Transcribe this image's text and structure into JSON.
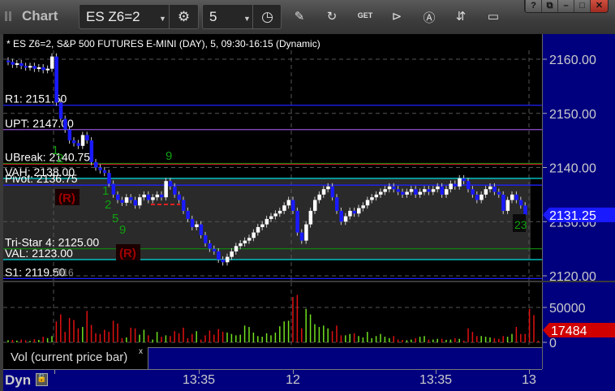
{
  "window": {
    "title": "Chart",
    "buttons": [
      "?",
      "restore",
      "minimize",
      "maximize",
      "close"
    ]
  },
  "toolbar": {
    "symbol": "ES Z6=2",
    "interval": "5",
    "tools": [
      "settings-icon",
      "clock-icon",
      "pencil-icon",
      "refresh-chart-icon",
      "get-icon",
      "play-icon",
      "analysis-a-icon",
      "link-icon",
      "comment-icon"
    ]
  },
  "header": {
    "description": "* ES Z6=2, S&P 500 FUTURES E-MINI (DAY), 5, 09:30-16:15 (Dynamic)"
  },
  "price_axis": {
    "ticks": [
      "2160.00",
      "2150.00",
      "2140.00",
      "2130.00",
      "2120.00"
    ],
    "last_price": "2131.25",
    "last_price_color": "#1a1aff"
  },
  "levels": [
    {
      "label": "R1: 2151.50",
      "value": 2151.5,
      "color": "#2020ff"
    },
    {
      "label": "UPT: 2147.00",
      "value": 2147,
      "color": "#9050d0"
    },
    {
      "label": "UBreak: 2140.75",
      "value": 2140.75,
      "color": "#108010"
    },
    {
      "label": "VAH: 2138.00",
      "value": 2138,
      "color": "#00e0e0"
    },
    {
      "label": "Pivot: 2136.75",
      "value": 2136.75,
      "color": "#2020ff"
    },
    {
      "label": "Tri-Star 4: 2125.00",
      "value": 2125,
      "color": "#108010"
    },
    {
      "label": "VAL: 2123.00",
      "value": 2123,
      "color": "#00e0e0"
    },
    {
      "label": "S1: 2119.50",
      "value": 2119.5,
      "color": "#2020ff"
    }
  ],
  "markers": {
    "r_label": "(R)",
    "count_last": "23",
    "watermark": "2016"
  },
  "chart_data": {
    "type": "candlestick",
    "xlabel": "",
    "ylabel": "",
    "ylim": [
      2118,
      2164
    ],
    "x_ticks": [
      "13:35",
      "12",
      "13:35",
      "13"
    ],
    "closes": [
      2159.5,
      2159,
      2159.25,
      2158.75,
      2158.5,
      2158.75,
      2158.25,
      2158.5,
      2158,
      2158.25,
      2160.5,
      2152,
      2149,
      2147,
      2145,
      2144.5,
      2144,
      2146,
      2145,
      2141,
      2140,
      2139.5,
      2139,
      2137,
      2135,
      2134,
      2133.5,
      2134.5,
      2134,
      2133,
      2134.5,
      2135,
      2134,
      2134.5,
      2135,
      2134.5,
      2137.5,
      2136.5,
      2135,
      2134,
      2132,
      2130.5,
      2129,
      2129.5,
      2127.5,
      2126,
      2125,
      2124.5,
      2123,
      2122.5,
      2123.5,
      2124.5,
      2125.5,
      2126,
      2126.5,
      2127,
      2128,
      2129,
      2129.5,
      2130.5,
      2131,
      2131.5,
      2132,
      2133,
      2134,
      2132,
      2128,
      2126.5,
      2129.5,
      2132,
      2134,
      2135,
      2136,
      2136.5,
      2134.5,
      2132,
      2130,
      2131,
      2132,
      2131.5,
      2132.5,
      2133,
      2134,
      2134.5,
      2135,
      2135.5,
      2136,
      2136.5,
      2136,
      2135.5,
      2135,
      2135.5,
      2136,
      2135,
      2135.5,
      2136,
      2135.5,
      2136,
      2136.5,
      2135,
      2136,
      2137,
      2136.5,
      2138,
      2137.5,
      2136,
      2135,
      2134,
      2135,
      2136,
      2136.5,
      2135.5,
      2135,
      2132,
      2134,
      2135,
      2134,
      2133,
      2131.25
    ],
    "volume": {
      "label": "Vol (current price bar)",
      "ticks": [
        "50000",
        "0"
      ],
      "last": "17484",
      "last_color": "#d00000",
      "values": [
        3000,
        3500,
        2500,
        4000,
        3000,
        2000,
        4500,
        3500,
        8000,
        6000,
        9000,
        30000,
        40000,
        15000,
        35000,
        32000,
        20000,
        22000,
        45000,
        25000,
        13000,
        12000,
        18000,
        15000,
        31000,
        27000,
        6000,
        7000,
        21000,
        20000,
        11000,
        18000,
        10000,
        4000,
        15000,
        8000,
        10000,
        9000,
        16000,
        13000,
        21000,
        6000,
        12000,
        16000,
        4000,
        10000,
        17000,
        11000,
        19000,
        15000,
        14000,
        12000,
        10000,
        11000,
        24000,
        22000,
        14000,
        9000,
        8000,
        13000,
        10000,
        14000,
        23000,
        30000,
        31000,
        65000,
        68000,
        20000,
        48000,
        40000,
        26000,
        22000,
        24000,
        20000,
        16000,
        24000,
        10000,
        10000,
        12000,
        13000,
        9000,
        7000,
        15000,
        6000,
        9000,
        12000,
        8000,
        6000,
        9000,
        4000,
        3500,
        3000,
        4000,
        6000,
        8000,
        9000,
        4000,
        4000,
        5000,
        5000,
        3500,
        4000,
        6000,
        5000,
        2500,
        20000,
        15000,
        9000,
        9000,
        8000,
        7000,
        6000,
        5000,
        9000,
        8000,
        12000,
        22000,
        12000,
        12000,
        48000,
        39000,
        2500,
        17484
      ]
    }
  },
  "vol_panel": {
    "close_label": "x"
  },
  "time_axis": {
    "mode": "Dyn"
  }
}
